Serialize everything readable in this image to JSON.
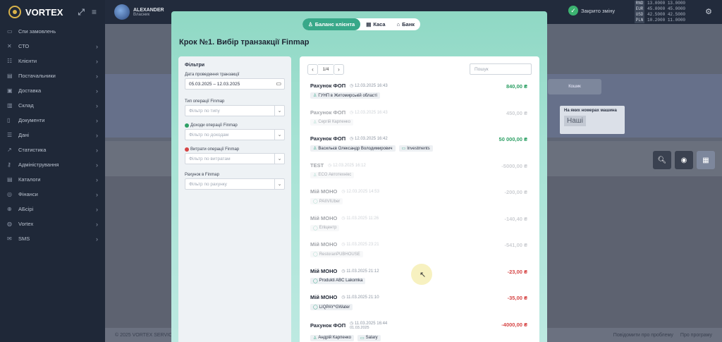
{
  "brand": {
    "name": "VORTEX"
  },
  "user": {
    "name": "ALEXANDER",
    "role": "Власник"
  },
  "closed_day": "Закрито зміну",
  "rates": [
    {
      "cur": "RND",
      "buy": "13.0000",
      "sell": "13.0000"
    },
    {
      "cur": "EUR",
      "buy": "45.0000",
      "sell": "45.0000"
    },
    {
      "cur": "USD",
      "buy": "42.5000",
      "sell": "42.5000"
    },
    {
      "cur": "PLN",
      "buy": "10.2000",
      "sell": "11.0000"
    }
  ],
  "sidebar": {
    "items": [
      {
        "label": "Cпи замовлень",
        "icon": "monitor-icon",
        "chev": false
      },
      {
        "label": "СТО",
        "icon": "wrench-icon",
        "chev": true
      },
      {
        "label": "Клієнти",
        "icon": "people-icon",
        "chev": true
      },
      {
        "label": "Постачальники",
        "icon": "truck-icon",
        "chev": true
      },
      {
        "label": "Доставка",
        "icon": "box-icon",
        "chev": true
      },
      {
        "label": "Склад",
        "icon": "warehouse-icon",
        "chev": true
      },
      {
        "label": "Документи",
        "icon": "document-icon",
        "chev": true
      },
      {
        "label": "Дані",
        "icon": "database-icon",
        "chev": true
      },
      {
        "label": "Статистика",
        "icon": "chart-icon",
        "chev": true
      },
      {
        "label": "Адміністрування",
        "icon": "key-icon",
        "chev": true
      },
      {
        "label": "Каталоги",
        "icon": "catalog-icon",
        "chev": true
      },
      {
        "label": "Фінанси",
        "icon": "money-icon",
        "chev": true
      },
      {
        "label": "AБсірі",
        "icon": "globe-icon",
        "chev": true
      },
      {
        "label": "Vortex",
        "icon": "vortex-icon",
        "chev": true
      },
      {
        "label": "SMS",
        "icon": "sms-icon",
        "chev": true
      }
    ]
  },
  "footer": {
    "copyright": "© 2025 VORTEX SERVICES",
    "report": "Повідомити про проблему",
    "about": "Про програму"
  },
  "background": {
    "button": "Кошик",
    "box_title": "На яких номерах машина",
    "box_value": "Наші"
  },
  "modal": {
    "tabs": [
      {
        "label": "Баланс клієнта",
        "icon": "person-icon",
        "active": true
      },
      {
        "label": "Каса",
        "icon": "cash-register-icon",
        "active": false
      },
      {
        "label": "Банк",
        "icon": "bank-icon",
        "active": false
      }
    ],
    "title": "Крок №1. Вибір транзакції Finmap",
    "filters": {
      "heading": "Фільтри",
      "date_label": "Дата проведення транзакції",
      "date_value": "05.03.2025 – 12.03.2025",
      "type_label": "Тип операції Finmap",
      "type_placeholder": "Фільтр по типу",
      "income_label": "Доходи операції Finmap",
      "income_placeholder": "Фільтр по доходам",
      "expense_label": "Витрати операції Finmap",
      "expense_placeholder": "Фільтр по витратам",
      "account_label": "Рахунок в Finmap",
      "account_placeholder": "Фільтр по рахунку"
    },
    "pager": {
      "page": "1/4"
    },
    "search_placeholder": "Пошук",
    "transactions": [
      {
        "name": "Рахунок ФОП",
        "date": "12.03.2025 16:43",
        "date2": "",
        "amount": "840,00 ₴",
        "kind": "green",
        "faded": false,
        "tags": [
          {
            "icon": "person-icon",
            "text": "ГУНП в Житомирській області"
          }
        ]
      },
      {
        "name": "Рахунок ФОП",
        "date": "12.03.2025 16:43",
        "date2": "",
        "amount": "450,00 ₴",
        "kind": "grey",
        "faded": true,
        "tags": [
          {
            "icon": "person-icon",
            "text": "Сергій Карпенко"
          }
        ]
      },
      {
        "name": "Рахунок ФОП",
        "date": "12.03.2025 16:42",
        "date2": "",
        "amount": "50 000,00 ₴",
        "kind": "green",
        "faded": false,
        "tags": [
          {
            "icon": "person-icon",
            "text": "Васильєв Олександр Володимирович"
          },
          {
            "icon": "calendar-icon",
            "text": "Investments"
          }
        ]
      },
      {
        "name": "TEST",
        "date": "12.03.2025 16:12",
        "date2": "",
        "amount": "-5000,00 ₴",
        "kind": "grey",
        "faded": true,
        "tags": [
          {
            "icon": "person-icon",
            "text": "ECO Автотехнікс"
          }
        ]
      },
      {
        "name": "Мій МОНО",
        "date": "12.03.2025 14:53",
        "date2": "",
        "amount": "-200,00 ₴",
        "kind": "grey",
        "faded": true,
        "tags": [
          {
            "icon": "comment-icon",
            "text": "PAIIVIUber"
          }
        ]
      },
      {
        "name": "Мій МОНО",
        "date": "11.03.2025 11:26",
        "date2": "",
        "amount": "-140,40 ₴",
        "kind": "grey",
        "faded": true,
        "tags": [
          {
            "icon": "comment-icon",
            "text": "Епіцентр"
          }
        ]
      },
      {
        "name": "Мій МОНО",
        "date": "11.03.2025 23:21",
        "date2": "",
        "amount": "-541,00 ₴",
        "kind": "grey",
        "faded": true,
        "tags": [
          {
            "icon": "comment-icon",
            "text": "RestoranPUBHOUSE"
          }
        ]
      },
      {
        "name": "Мій МОНО",
        "date": "11.03.2025 21:12",
        "date2": "",
        "amount": "-23,00 ₴",
        "kind": "red",
        "faded": false,
        "tags": [
          {
            "icon": "comment-icon",
            "text": "Produkti ABC Lakomka"
          }
        ]
      },
      {
        "name": "Мій МОНО",
        "date": "11.03.2025 21:10",
        "date2": "",
        "amount": "-35,00 ₴",
        "kind": "red",
        "faded": false,
        "tags": [
          {
            "icon": "comment-icon",
            "text": "LIQPAY*GWater"
          }
        ]
      },
      {
        "name": "Рахунок ФОП",
        "date": "11.03.2025 16:44",
        "date2": "01.03.2025",
        "amount": "-4000,00 ₴",
        "kind": "red",
        "faded": false,
        "tags": [
          {
            "icon": "person-icon",
            "text": "Андрій Карпенко"
          },
          {
            "icon": "calendar-icon",
            "text": "Salary"
          }
        ]
      }
    ]
  },
  "colors": {
    "accent": "#38a889",
    "positive": "#2ea065",
    "negative": "#d64545",
    "sidebar": "#1f2838"
  }
}
